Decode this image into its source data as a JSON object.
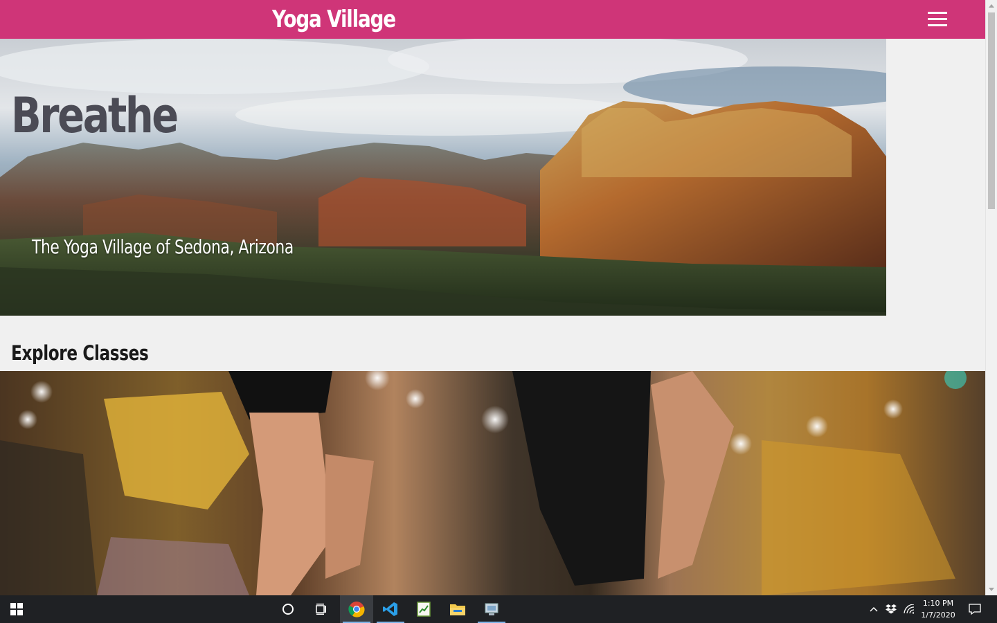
{
  "header": {
    "brand": "Yoga Village",
    "menu_icon": "hamburger-menu-icon",
    "background_color": "#cf3578"
  },
  "hero": {
    "title": "Breathe",
    "subtitle": "The Yoga Village of Sedona, Arizona",
    "image": "sedona-red-rock-mountains-photo"
  },
  "classes": {
    "heading": "Explore Classes",
    "image": "yoga-class-stretching-photo"
  },
  "taskbar": {
    "start_icon": "windows-start-icon",
    "search_icon": "cortana-circle-icon",
    "taskview_icon": "task-view-icon",
    "apps": [
      {
        "icon": "chrome-icon",
        "active": true
      },
      {
        "icon": "vscode-icon",
        "active": false
      },
      {
        "icon": "notepad-chart-icon",
        "active": false
      },
      {
        "icon": "file-explorer-icon",
        "active": false
      },
      {
        "icon": "network-app-icon",
        "active": false
      }
    ],
    "tray": {
      "chevron_icon": "chevron-up-icon",
      "dropbox_icon": "dropbox-icon",
      "wifi_icon": "wifi-icon",
      "time": "1:10 PM",
      "date": "1/7/2020",
      "notification_icon": "action-center-icon"
    }
  }
}
